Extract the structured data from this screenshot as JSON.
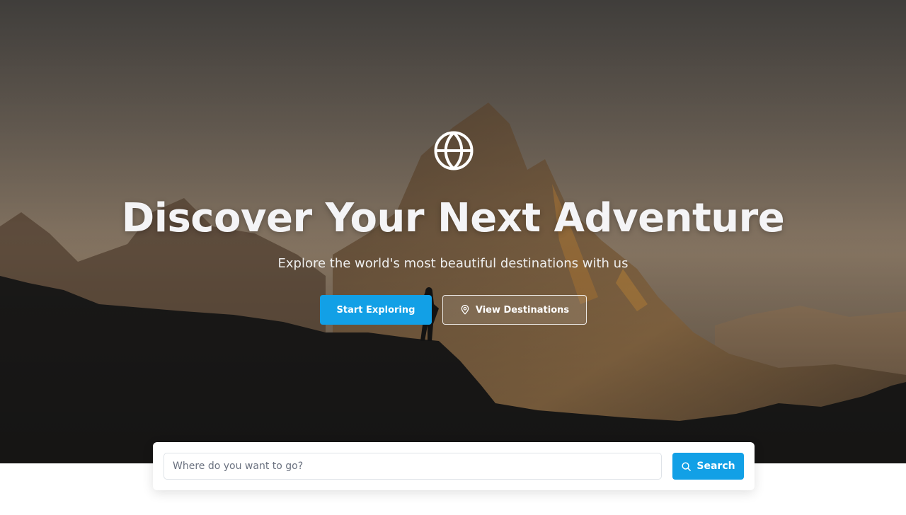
{
  "hero": {
    "icon": "globe-icon",
    "headline": "Discover Your Next Adventure",
    "subheadline": "Explore the world's most beautiful destinations with us",
    "primary_button": {
      "label": "Start Exploring"
    },
    "secondary_button": {
      "label": "View Destinations",
      "icon": "map-pin-icon"
    }
  },
  "search": {
    "placeholder": "Where do you want to go?",
    "value": "",
    "button_label": "Search",
    "button_icon": "search-icon"
  },
  "colors": {
    "accent": "#12a0e6",
    "headline": "#f4f4f6",
    "page_background": "#ffffff"
  }
}
